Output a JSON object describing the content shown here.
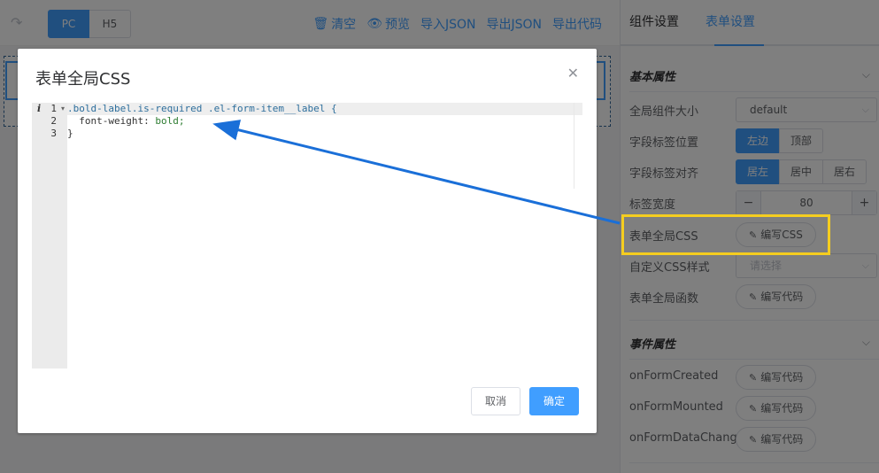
{
  "toolbar": {
    "device_pc": "PC",
    "device_h5": "H5",
    "actions": [
      {
        "icon": "trash-icon",
        "glyph": "🗑",
        "label": "清空"
      },
      {
        "icon": "eye-icon",
        "glyph": "👁",
        "label": "预览"
      },
      {
        "label": "导入JSON"
      },
      {
        "label": "导出JSON"
      },
      {
        "label": "导出代码"
      }
    ]
  },
  "panel": {
    "tabs": [
      "组件设置",
      "表单设置"
    ],
    "active_tab": "表单设置",
    "basic_section": "基本属性",
    "rows": {
      "size_label": "全局组件大小",
      "size_value": "default",
      "label_pos_label": "字段标签位置",
      "label_pos_options": [
        "左边",
        "顶部"
      ],
      "label_align_label": "字段标签对齐",
      "label_align_options": [
        "居左",
        "居中",
        "居右"
      ],
      "label_width_label": "标签宽度",
      "label_width_value": "80",
      "css_label": "表单全局CSS",
      "css_button": "编写CSS",
      "custom_css_label": "自定义CSS样式",
      "custom_css_placeholder": "请选择",
      "func_label": "表单全局函数",
      "func_button": "编写代码"
    },
    "event_section": "事件属性",
    "events": [
      {
        "label": "onFormCreated",
        "button": "编写代码"
      },
      {
        "label": "onFormMounted",
        "button": "编写代码"
      },
      {
        "label": "onFormDataChange",
        "button": "编写代码"
      }
    ]
  },
  "dialog": {
    "title": "表单全局CSS",
    "code_lines": [
      {
        "num": "1",
        "text": ".bold-label.is-required .el-form-item__label {"
      },
      {
        "num": "2",
        "prop": "  font-weight: ",
        "val": "bold;"
      },
      {
        "num": "3",
        "text": "}"
      }
    ],
    "cancel": "取消",
    "confirm": "确定"
  },
  "colors": {
    "primary": "#409eff",
    "highlight": "#f5cd1f",
    "arrow": "#1a6fd8"
  }
}
